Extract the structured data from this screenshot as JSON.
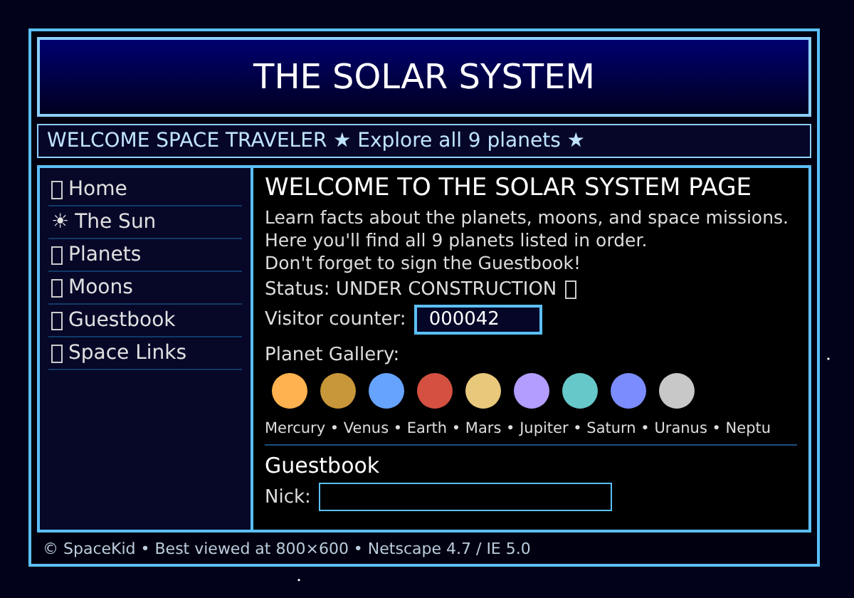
{
  "header": {
    "title": "THE SOLAR SYSTEM"
  },
  "marquee": "WELCOME SPACE TRAVELER ★ Explore all 9 planets ★",
  "nav": [
    {
      "kind": "box",
      "label": "Home"
    },
    {
      "kind": "glyph",
      "icon": "☀",
      "label": "The Sun"
    },
    {
      "kind": "box",
      "label": "Planets"
    },
    {
      "kind": "box",
      "label": "Moons"
    },
    {
      "kind": "box",
      "label": "Guestbook"
    },
    {
      "kind": "box",
      "label": "Space Links"
    }
  ],
  "content": {
    "heading": "WELCOME TO THE SOLAR SYSTEM PAGE",
    "intro": [
      "Learn facts about the planets, moons, and space missions.",
      "Here you'll find all 9 planets listed in order.",
      "Don't forget to sign the Guestbook!"
    ],
    "status": "Status: UNDER CONSTRUCTION",
    "counter_label": "Visitor counter:",
    "counter_value": "000042",
    "gallery_label": "Planet Gallery:",
    "planets": [
      {
        "color": "#ffb24f"
      },
      {
        "color": "#c8973a"
      },
      {
        "color": "#66a3ff"
      },
      {
        "color": "#d45040"
      },
      {
        "color": "#e8c87a"
      },
      {
        "color": "#b39dff"
      },
      {
        "color": "#66c8c8"
      },
      {
        "color": "#7b8cff"
      },
      {
        "color": "#c8c8c8"
      }
    ],
    "planet_names": "Mercury • Venus • Earth • Mars • Jupiter • Saturn • Uranus • Neptu",
    "guestbook_heading": "Guestbook",
    "nick_label": "Nick:"
  },
  "footer": "© SpaceKid • Best viewed at 800×600 • Netscape 4.7 / IE 5.0"
}
